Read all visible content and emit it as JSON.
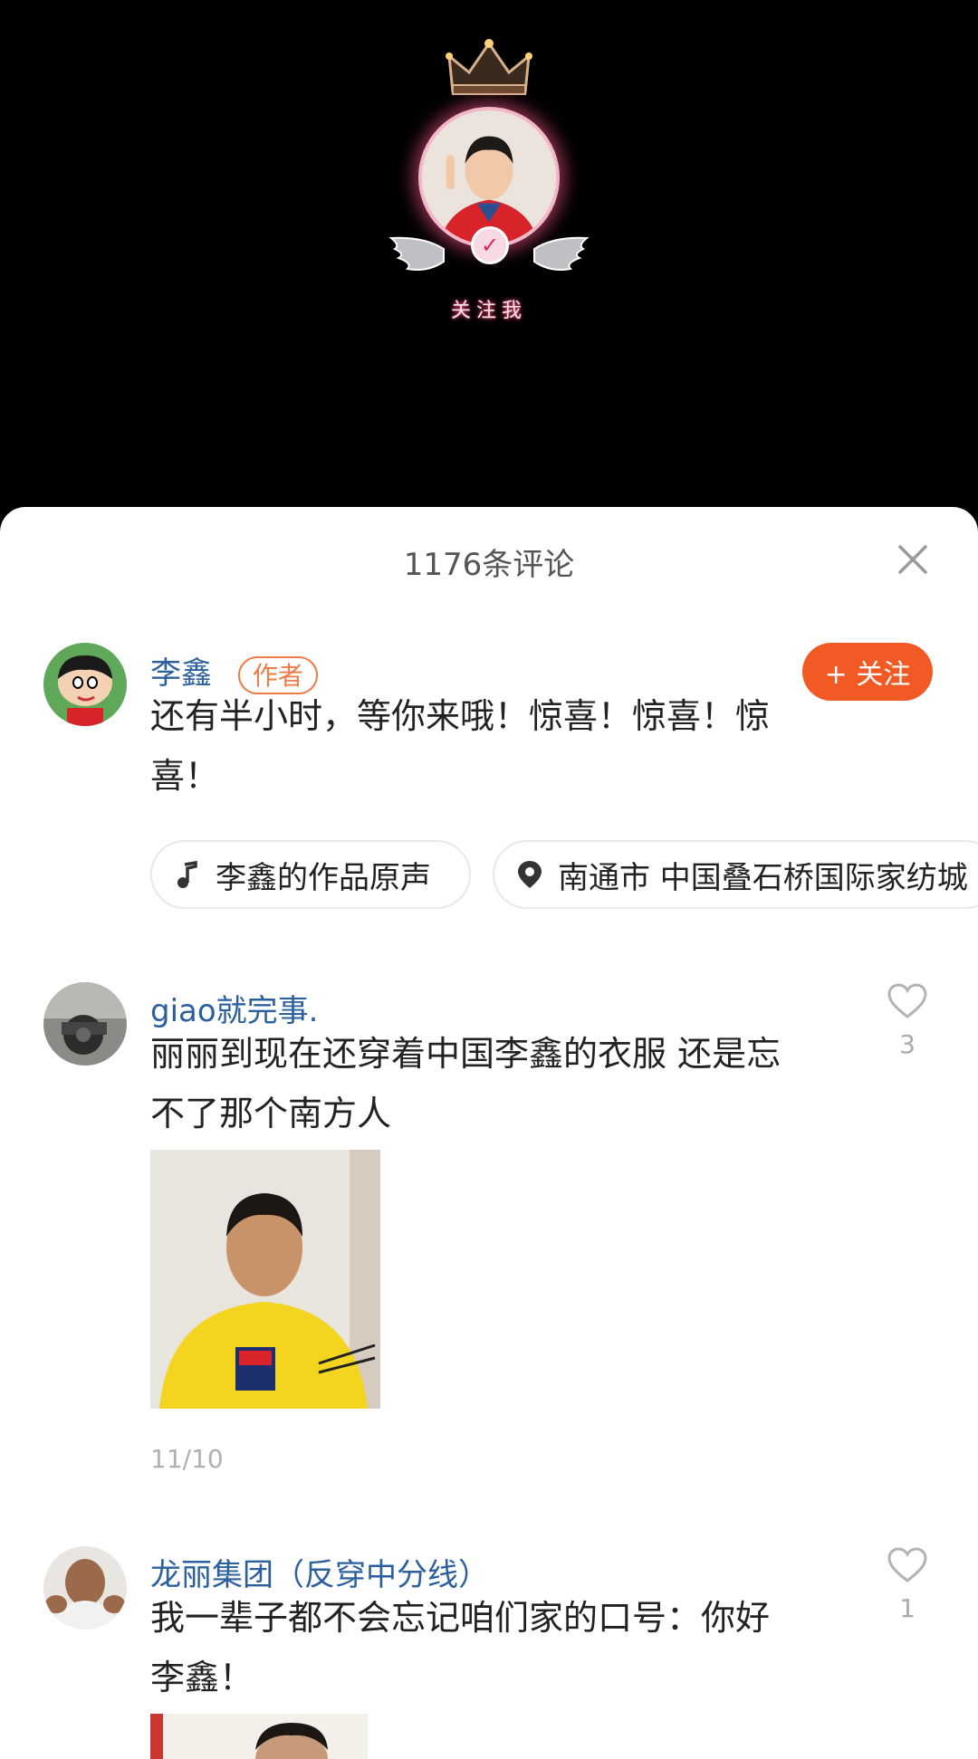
{
  "video": {
    "follow_me_label": "关注我",
    "badge_icon": "check-icon"
  },
  "sheet": {
    "title": "1176条评论",
    "close_icon": "close-icon"
  },
  "author_comment": {
    "username": "李鑫",
    "tag": "作者",
    "follow_label": "+ 关注",
    "text": "还有半小时，等你来哦！惊喜！惊喜！惊喜！",
    "chips": [
      {
        "icon": "music-note-icon",
        "label": "李鑫的作品原声"
      },
      {
        "icon": "location-pin-icon",
        "label": "南通市 中国叠石桥国际家纺城"
      }
    ]
  },
  "comments": [
    {
      "username": "giao就完事.",
      "text": "丽丽到现在还穿着中国李鑫的衣服 还是忘不了那个南方人",
      "likes": "3",
      "date": "11/10",
      "has_image": true
    },
    {
      "username": "龙丽集团（反穿中分线）",
      "text": "我一辈子都不会忘记咱们家的口号：你好李鑫！",
      "likes": "1",
      "has_image": true
    }
  ],
  "colors": {
    "accent": "#f15a24",
    "username": "#2b5f9e",
    "sheet_bg": "#ffffff",
    "video_bg": "#000000"
  }
}
